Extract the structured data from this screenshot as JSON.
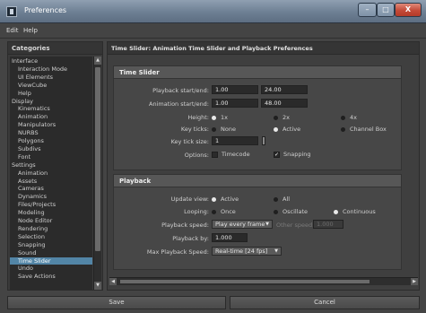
{
  "window": {
    "title": "Preferences"
  },
  "titlebar": {
    "minimize": "–",
    "maximize": "□",
    "close": "X"
  },
  "menu": [
    "Edit",
    "Help"
  ],
  "categories": {
    "header": "Categories",
    "items": [
      {
        "label": "Interface",
        "level": 0
      },
      {
        "label": "Interaction Mode",
        "level": 1
      },
      {
        "label": "UI Elements",
        "level": 1
      },
      {
        "label": "ViewCube",
        "level": 1
      },
      {
        "label": "Help",
        "level": 1
      },
      {
        "label": "Display",
        "level": 0
      },
      {
        "label": "Kinematics",
        "level": 1
      },
      {
        "label": "Animation",
        "level": 1
      },
      {
        "label": "Manipulators",
        "level": 1
      },
      {
        "label": "NURBS",
        "level": 1
      },
      {
        "label": "Polygons",
        "level": 1
      },
      {
        "label": "Subdivs",
        "level": 1
      },
      {
        "label": "Font",
        "level": 1
      },
      {
        "label": "Settings",
        "level": 0
      },
      {
        "label": "Animation",
        "level": 1
      },
      {
        "label": "Assets",
        "level": 1
      },
      {
        "label": "Cameras",
        "level": 1
      },
      {
        "label": "Dynamics",
        "level": 1
      },
      {
        "label": "Files/Projects",
        "level": 1
      },
      {
        "label": "Modeling",
        "level": 1
      },
      {
        "label": "Node Editor",
        "level": 1
      },
      {
        "label": "Rendering",
        "level": 1
      },
      {
        "label": "Selection",
        "level": 1
      },
      {
        "label": "Snapping",
        "level": 1
      },
      {
        "label": "Sound",
        "level": 1
      },
      {
        "label": "Time Slider",
        "level": 1,
        "selected": true
      },
      {
        "label": "Undo",
        "level": 1
      },
      {
        "label": "Save Actions",
        "level": 1
      }
    ]
  },
  "pref_title": "Time Slider: Animation Time Slider and Playback Preferences",
  "time_slider": {
    "header": "Time Slider",
    "playback_label": "Playback start/end:",
    "playback_start": "1.00",
    "playback_end": "24.00",
    "animation_label": "Animation start/end:",
    "animation_start": "1.00",
    "animation_end": "48.00",
    "height_label": "Height:",
    "height_options": [
      "1x",
      "2x",
      "4x"
    ],
    "height_selected": 0,
    "keyticks_label": "Key ticks:",
    "keyticks_options": [
      "None",
      "Active",
      "Channel Box"
    ],
    "keyticks_selected": 1,
    "keyticksize_label": "Key tick size:",
    "keyticksize_value": "1",
    "options_label": "Options:",
    "timecode_label": "Timecode",
    "timecode_checked": false,
    "snapping_label": "Snapping",
    "snapping_checked": true
  },
  "playback": {
    "header": "Playback",
    "update_label": "Update view:",
    "update_options": [
      "Active",
      "All"
    ],
    "update_selected": 0,
    "looping_label": "Looping:",
    "looping_options": [
      "Once",
      "Oscillate",
      "Continuous"
    ],
    "looping_selected": 2,
    "speed_label": "Playback speed:",
    "speed_value": "Play every frame",
    "other_speed_label": "Other speed:",
    "other_speed_value": "1.000",
    "playby_label": "Playback by:",
    "playby_value": "1.000",
    "maxspeed_label": "Max Playback Speed:",
    "maxspeed_value": "Real-time [24 fps]"
  },
  "buttons": {
    "save": "Save",
    "cancel": "Cancel"
  }
}
